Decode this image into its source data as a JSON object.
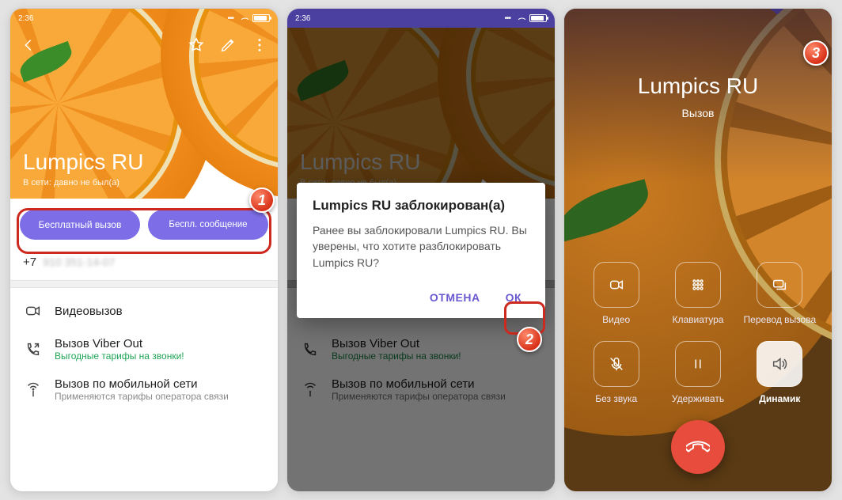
{
  "statusbar": {
    "time": "2:36"
  },
  "screen1": {
    "contact_name": "Lumpics RU",
    "status": "В сети: давно не был(а)",
    "btn_free_call": "Бесплатный вызов",
    "btn_free_msg": "Беспл. сообщение",
    "phone_prefix": "+7",
    "phone_rest": "910 351-14-07",
    "row_video": "Видеовызов",
    "row_viberout": "Вызов Viber Out",
    "row_viberout_hint": "Выгодные тарифы на звонки!",
    "row_cellular": "Вызов по мобильной сети",
    "row_cellular_hint": "Применяются тарифы оператора связи"
  },
  "screen2": {
    "dialog_title": "Lumpics RU заблокирован(а)",
    "dialog_body": "Ранее вы заблокировали Lumpics RU. Вы уверены, что хотите разблокировать Lumpics RU?",
    "cancel": "ОТМЕНА",
    "ok": "ОК"
  },
  "screen3": {
    "contact_name": "Lumpics RU",
    "call_status": "Вызов",
    "btn_video": "Видео",
    "btn_keypad": "Клавиатура",
    "btn_transfer": "Перевод вызова",
    "btn_mute": "Без звука",
    "btn_hold": "Удерживать",
    "btn_speaker": "Динамик"
  },
  "steps": {
    "s1": "1",
    "s2": "2",
    "s3": "3"
  }
}
